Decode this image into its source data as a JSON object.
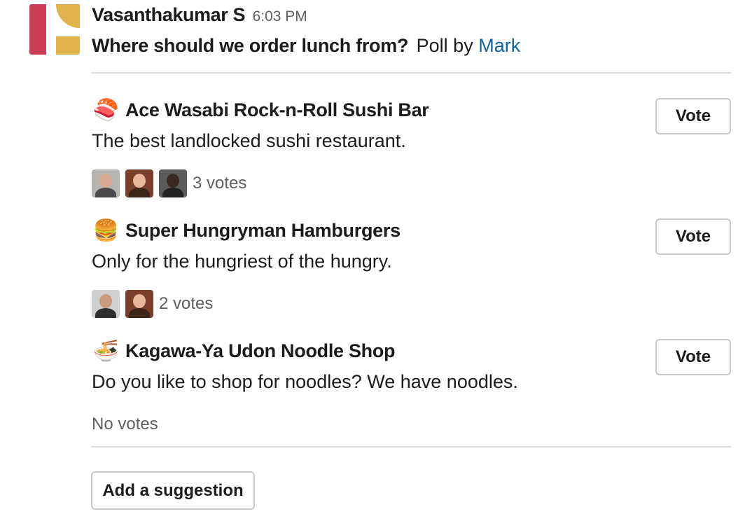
{
  "message": {
    "sender": "Vasanthakumar S",
    "time": "6:03 PM",
    "question": "Where should we order lunch from?",
    "poll_by_text": "Poll by",
    "poll_author": "Mark"
  },
  "colors": {
    "link": "#1264a3",
    "avatar_red": "#cc3b58",
    "avatar_yellow": "#e0b34d",
    "muted_text": "#616061"
  },
  "options": [
    {
      "icon": "sushi-icon",
      "emoji": "🍣",
      "title": "Ace Wasabi Rock-n-Roll Sushi Bar",
      "description": "The best landlocked sushi restaurant.",
      "vote_count_text": "3 votes",
      "vote_label": "Vote",
      "voter_count": 3
    },
    {
      "icon": "hamburger-icon",
      "emoji": "🍔",
      "title": "Super Hungryman Hamburgers",
      "description": "Only for the hungriest of the hungry.",
      "vote_count_text": "2 votes",
      "vote_label": "Vote",
      "voter_count": 2
    },
    {
      "icon": "noodle-bowl-icon",
      "emoji": "🍜",
      "title": "Kagawa-Ya Udon Noodle Shop",
      "description": "Do you like to shop for noodles? We have noodles.",
      "vote_count_text": "No votes",
      "vote_label": "Vote",
      "voter_count": 0
    }
  ],
  "add_suggestion_label": "Add a suggestion"
}
